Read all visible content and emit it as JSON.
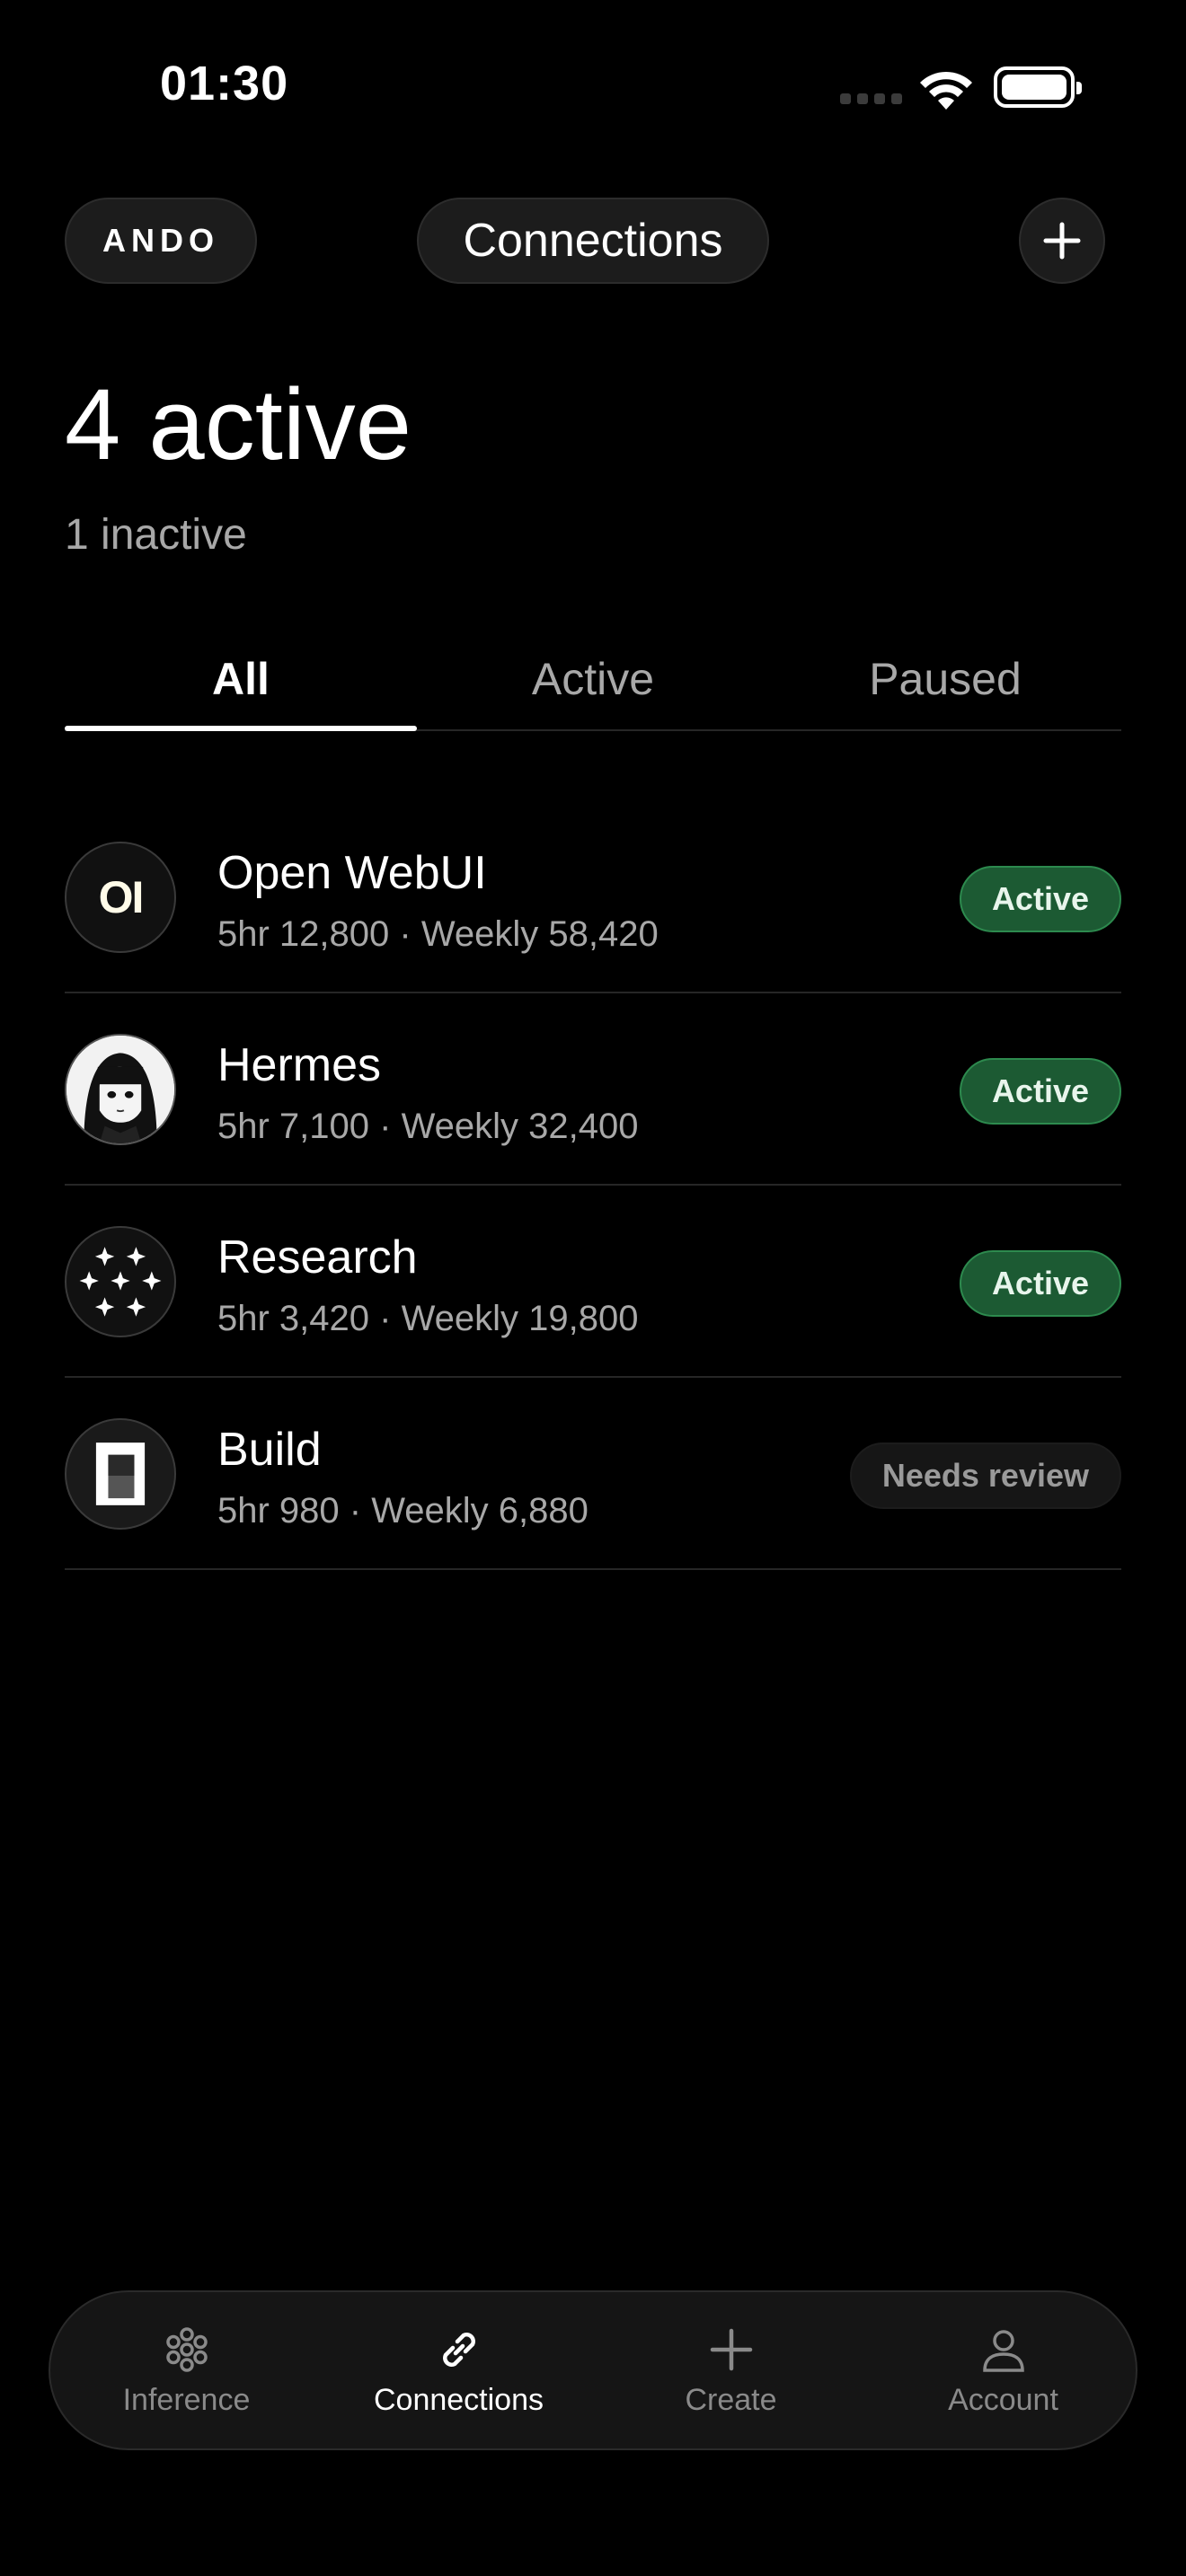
{
  "status_bar": {
    "time": "01:30"
  },
  "header": {
    "brand": "ANDO",
    "title": "Connections"
  },
  "summary": {
    "title": "4 active",
    "subtitle": "1 inactive"
  },
  "tabs": [
    {
      "label": "All",
      "selected": true
    },
    {
      "label": "Active",
      "selected": false
    },
    {
      "label": "Paused",
      "selected": false
    }
  ],
  "connections": [
    {
      "name": "Open WebUI",
      "logo_text": "OI",
      "meta": "5hr 12,800 · Weekly 58,420",
      "status": "Active",
      "status_kind": "active",
      "icon": "open-webui-logo-icon"
    },
    {
      "name": "Hermes",
      "meta": "5hr 7,100 · Weekly 32,400",
      "status": "Active",
      "status_kind": "active",
      "icon": "hermes-avatar-icon"
    },
    {
      "name": "Research",
      "meta": "5hr 3,420 · Weekly 19,800",
      "status": "Active",
      "status_kind": "active",
      "icon": "sparkles-grid-icon"
    },
    {
      "name": "Build",
      "meta": "5hr 980 · Weekly 6,880",
      "status": "Needs review",
      "status_kind": "review",
      "icon": "build-block-icon"
    }
  ],
  "bottom_nav": [
    {
      "label": "Inference",
      "icon": "flower-icon",
      "selected": false
    },
    {
      "label": "Connections",
      "icon": "link-icon",
      "selected": true
    },
    {
      "label": "Create",
      "icon": "plus-icon",
      "selected": false
    },
    {
      "label": "Account",
      "icon": "person-icon",
      "selected": false
    }
  ],
  "colors": {
    "background": "#000000",
    "active_badge": "#1c5a33",
    "muted_text": "#a8a8a8"
  }
}
